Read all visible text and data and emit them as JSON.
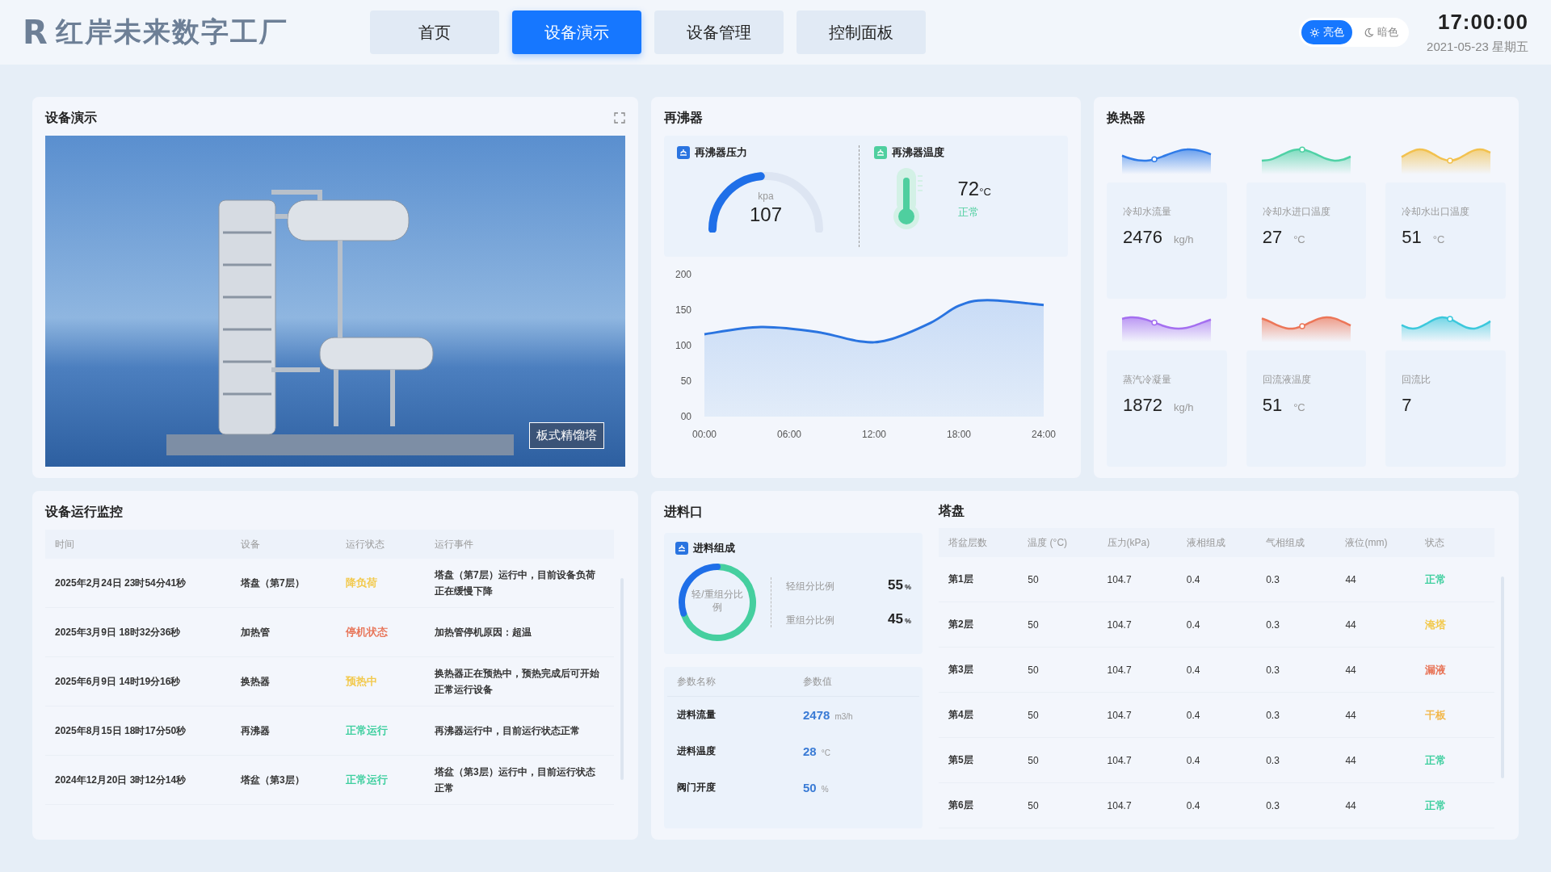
{
  "header": {
    "logo_letter": "R",
    "title": "红岸未来数字工厂",
    "nav": [
      {
        "label": "首页",
        "selected": false
      },
      {
        "label": "设备演示",
        "selected": true
      },
      {
        "label": "设备管理",
        "selected": false
      },
      {
        "label": "控制面板",
        "selected": false
      }
    ],
    "theme": [
      {
        "kind": "light",
        "label": "亮色",
        "selected": true
      },
      {
        "kind": "dark",
        "label": "暗色",
        "selected": false
      }
    ],
    "time": "17:00:00",
    "date": "2021-05-23 星期五"
  },
  "demo": {
    "title": "设备演示",
    "caption": "板式精馏塔"
  },
  "reboiler": {
    "title": "再沸器",
    "pressure": {
      "title": "再沸器压力",
      "unit": "kpa",
      "value": "107",
      "level": 0.47
    },
    "temperature": {
      "title": "再沸器温度",
      "value": "72",
      "unit": "°C",
      "status": "正常"
    },
    "chart_data": {
      "type": "area",
      "x": [
        0,
        4,
        8,
        11,
        13,
        16,
        18,
        20,
        24
      ],
      "ylim": [
        0,
        200
      ],
      "xlim": [
        0,
        24
      ],
      "yticks": [
        {
          "value": 0,
          "label": "00"
        },
        {
          "value": 50,
          "label": "50"
        },
        {
          "value": 100,
          "label": "100"
        },
        {
          "value": 150,
          "label": "150"
        },
        {
          "value": 200,
          "label": "200"
        }
      ],
      "xticks": [
        {
          "value": 0,
          "label": "00:00"
        },
        {
          "value": 6,
          "label": "06:00"
        },
        {
          "value": 12,
          "label": "12:00"
        },
        {
          "value": 18,
          "label": "18:00"
        },
        {
          "value": 24,
          "label": "24:00"
        }
      ],
      "series": [
        {
          "color": "#2a74e0",
          "values": [
            116,
            126,
            119,
            106,
            108,
            132,
            156,
            164,
            157
          ]
        }
      ]
    }
  },
  "exchanger": {
    "title": "换热器",
    "items": [
      {
        "label": "冷却水流量",
        "value": "2476",
        "unit": "kg/h",
        "color": "#2f7be8"
      },
      {
        "label": "冷却水进口温度",
        "value": "27",
        "unit": "°C",
        "color": "#4fd1a5"
      },
      {
        "label": "冷却水出口温度",
        "value": "51",
        "unit": "°C",
        "color": "#f2c14e"
      },
      {
        "label": "蒸汽冷凝量",
        "value": "1872",
        "unit": "kg/h",
        "color": "#a46ff0"
      },
      {
        "label": "回流液温度",
        "value": "51",
        "unit": "°C",
        "color": "#ec7658"
      },
      {
        "label": "回流比",
        "value": "7",
        "color": "#3cc8dc"
      }
    ]
  },
  "monitor": {
    "title": "设备运行监控",
    "columns": [
      "时间",
      "设备",
      "运行状态",
      "运行事件"
    ],
    "rows": [
      {
        "time": "2025年2月24日 23时54分41秒",
        "device": "塔盘（第7层）",
        "status": "降负荷",
        "color": "#f2c94c",
        "event": "塔盘（第7层）运行中，目前设备负荷正在缓慢下降"
      },
      {
        "time": "2025年3月9日 18时32分36秒",
        "device": "加热管",
        "status": "停机状态",
        "color": "#e8765a",
        "event": "加热管停机原因：超温"
      },
      {
        "time": "2025年6月9日 14时19分16秒",
        "device": "换热器",
        "status": "预热中",
        "color": "#f2c94c",
        "event": "换热器正在预热中，预热完成后可开始正常运行设备"
      },
      {
        "time": "2025年8月15日 18时17分50秒",
        "device": "再沸器",
        "status": "正常运行",
        "color": "#3fcf9f",
        "event": "再沸器运行中，目前运行状态正常"
      },
      {
        "time": "2024年12月20日 3时12分14秒",
        "device": "塔盆（第3层）",
        "status": "正常运行",
        "color": "#3fcf9f",
        "event": "塔盆（第3层）运行中，目前运行状态正常"
      }
    ]
  },
  "feed": {
    "title": "进料口",
    "composition": {
      "title": "进料组成",
      "center_label": "轻/重组分比例",
      "level": 0.3,
      "ratios": [
        {
          "label": "轻组分比例",
          "value": "55",
          "unit": "%"
        },
        {
          "label": "重组分比例",
          "value": "45",
          "unit": "%"
        }
      ]
    },
    "params": {
      "columns": [
        "参数名称",
        "参数值"
      ],
      "rows": [
        {
          "name": "进料流量",
          "value": "2478",
          "unit": "m3/h"
        },
        {
          "name": "进料温度",
          "value": "28",
          "unit": "°C"
        },
        {
          "name": "阀门开度",
          "value": "50",
          "unit": "%"
        }
      ]
    }
  },
  "trays": {
    "title": "塔盘",
    "columns": [
      "塔盆层数",
      "温度 (°C)",
      "压力(kPa)",
      "液相组成",
      "气相组成",
      "液位(mm)",
      "状态"
    ],
    "rows": [
      {
        "cells": [
          "第1层",
          "50",
          "104.7",
          "0.4",
          "0.3",
          "44"
        ],
        "status": "正常",
        "color": "#3fcf9f"
      },
      {
        "cells": [
          "第2层",
          "50",
          "104.7",
          "0.4",
          "0.3",
          "44"
        ],
        "status": "淹塔",
        "color": "#f2c94c"
      },
      {
        "cells": [
          "第3层",
          "50",
          "104.7",
          "0.4",
          "0.3",
          "44"
        ],
        "status": "漏液",
        "color": "#e8765a"
      },
      {
        "cells": [
          "第4层",
          "50",
          "104.7",
          "0.4",
          "0.3",
          "44"
        ],
        "status": "干板",
        "color": "#f2b84c"
      },
      {
        "cells": [
          "第5层",
          "50",
          "104.7",
          "0.4",
          "0.3",
          "44"
        ],
        "status": "正常",
        "color": "#3fcf9f"
      },
      {
        "cells": [
          "第6层",
          "50",
          "104.7",
          "0.4",
          "0.3",
          "44"
        ],
        "status": "正常",
        "color": "#3fcf9f"
      }
    ]
  }
}
